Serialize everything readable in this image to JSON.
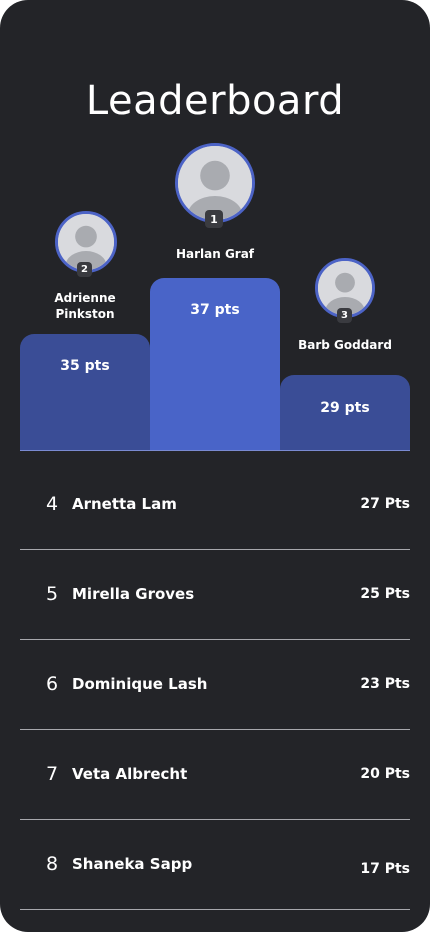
{
  "title": "Leaderboard",
  "podium": [
    {
      "rank": "1",
      "name": "Harlan Graf",
      "points": "37 pts"
    },
    {
      "rank": "2",
      "name": "Adrienne Pinkston",
      "points": "35 pts"
    },
    {
      "rank": "3",
      "name": "Barb Goddard",
      "points": "29 pts"
    }
  ],
  "list": [
    {
      "rank": "4",
      "name": "Arnetta Lam",
      "points": "27 Pts"
    },
    {
      "rank": "5",
      "name": "Mirella Groves",
      "points": "25 Pts"
    },
    {
      "rank": "6",
      "name": "Dominique Lash",
      "points": "23 Pts"
    },
    {
      "rank": "7",
      "name": "Veta Albrecht",
      "points": "20 Pts"
    },
    {
      "rank": "8",
      "name": "Shaneka Sapp",
      "points": "17 Pts"
    }
  ],
  "colors": {
    "background": "#232428",
    "first_bar": "#4964c8",
    "other_bars": "#3a4d96",
    "avatar_ring": "#4c63c6"
  },
  "icons": {
    "avatar": "user-placeholder-icon"
  }
}
